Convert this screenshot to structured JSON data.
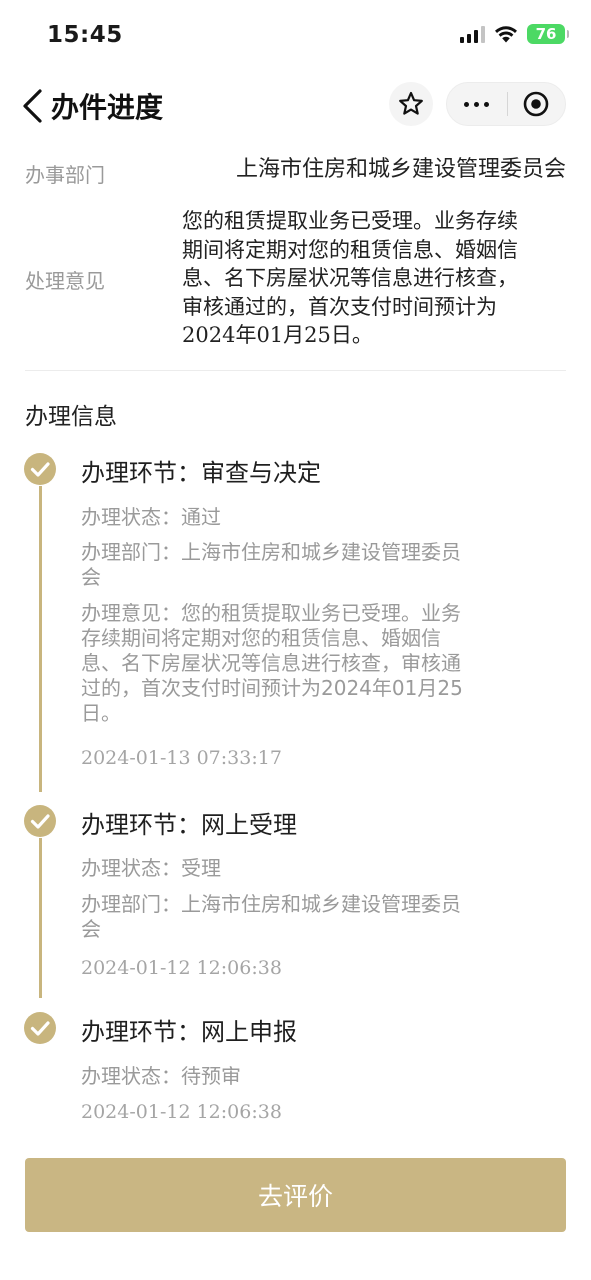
{
  "status_bar": {
    "time": "15:45",
    "battery": "76"
  },
  "nav": {
    "title": "办件进度"
  },
  "info": {
    "dept_label": "办事部门",
    "dept_value": "上海市住房和城乡建设管理委员会",
    "opinion_label": "处理意见",
    "opinion_lines": [
      "您的租赁提取业务已受理。业务存续",
      "期间将定期对您的租赁信息、婚姻信",
      "息、名下房屋状况等信息进行核查，",
      "审核通过的，首次支付时间预计为",
      "2024年01月25日。"
    ]
  },
  "section_title": "办理信息",
  "steps": [
    {
      "title": "办理环节：审查与决定",
      "status": "办理状态：通过",
      "dept_lines": [
        "办理部门：上海市住房和城乡建设管理委员",
        "会"
      ],
      "opinion_lines": [
        "办理意见：您的租赁提取业务已受理。业务",
        "存续期间将定期对您的租赁信息、婚姻信",
        "息、名下房屋状况等信息进行核查，审核通",
        "过的，首次支付时间预计为2024年01月25",
        "日。"
      ],
      "time": "2024-01-13 07:33:17"
    },
    {
      "title": "办理环节：网上受理",
      "status": "办理状态：受理",
      "dept_lines": [
        "办理部门：上海市住房和城乡建设管理委员",
        "会"
      ],
      "time": "2024-01-12 12:06:38"
    },
    {
      "title": "办理环节：网上申报",
      "status": "办理状态：待预审",
      "time": "2024-01-12 12:06:38"
    }
  ],
  "colors": {
    "accent": "#c9b683",
    "timeline": "#c8b57e",
    "label": "#9a9a9a"
  },
  "button": {
    "label": "去评价"
  }
}
